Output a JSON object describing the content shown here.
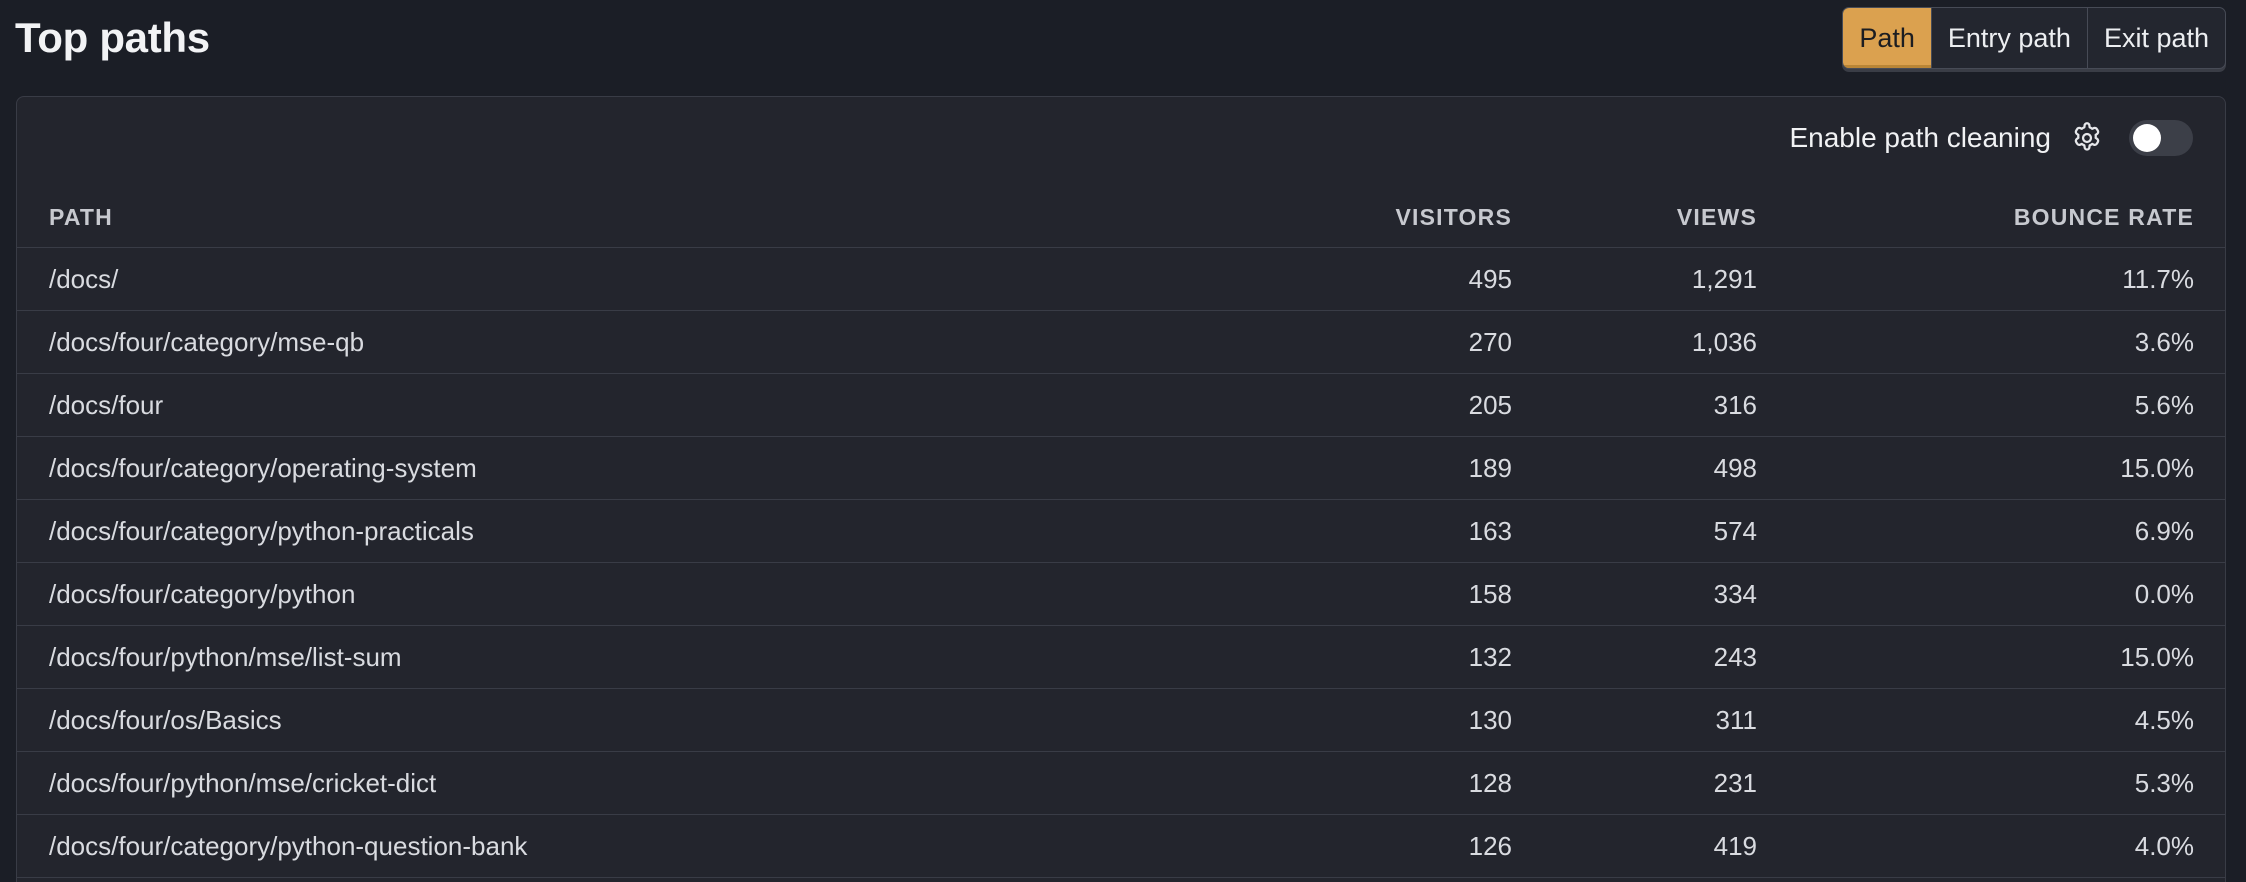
{
  "title": "Top paths",
  "tabs": [
    {
      "label": "Path",
      "active": true
    },
    {
      "label": "Entry path",
      "active": false
    },
    {
      "label": "Exit path",
      "active": false
    }
  ],
  "toolbar": {
    "path_cleaning_label": "Enable path cleaning",
    "settings_icon": "gear-icon",
    "path_cleaning_enabled": false
  },
  "table": {
    "columns": [
      "PATH",
      "VISITORS",
      "VIEWS",
      "BOUNCE RATE"
    ],
    "rows": [
      {
        "path": "/docs/",
        "visitors": "495",
        "views": "1,291",
        "bounce_rate": "11.7%"
      },
      {
        "path": "/docs/four/category/mse-qb",
        "visitors": "270",
        "views": "1,036",
        "bounce_rate": "3.6%"
      },
      {
        "path": "/docs/four",
        "visitors": "205",
        "views": "316",
        "bounce_rate": "5.6%"
      },
      {
        "path": "/docs/four/category/operating-system",
        "visitors": "189",
        "views": "498",
        "bounce_rate": "15.0%"
      },
      {
        "path": "/docs/four/category/python-practicals",
        "visitors": "163",
        "views": "574",
        "bounce_rate": "6.9%"
      },
      {
        "path": "/docs/four/category/python",
        "visitors": "158",
        "views": "334",
        "bounce_rate": "0.0%"
      },
      {
        "path": "/docs/four/python/mse/list-sum",
        "visitors": "132",
        "views": "243",
        "bounce_rate": "15.0%"
      },
      {
        "path": "/docs/four/os/Basics",
        "visitors": "130",
        "views": "311",
        "bounce_rate": "4.5%"
      },
      {
        "path": "/docs/four/python/mse/cricket-dict",
        "visitors": "128",
        "views": "231",
        "bounce_rate": "5.3%"
      },
      {
        "path": "/docs/four/category/python-question-bank",
        "visitors": "126",
        "views": "419",
        "bounce_rate": "4.0%"
      }
    ]
  },
  "colors": {
    "background": "#1b1e26",
    "card": "#23252d",
    "accent": "#dba14f",
    "border": "#393c46"
  }
}
